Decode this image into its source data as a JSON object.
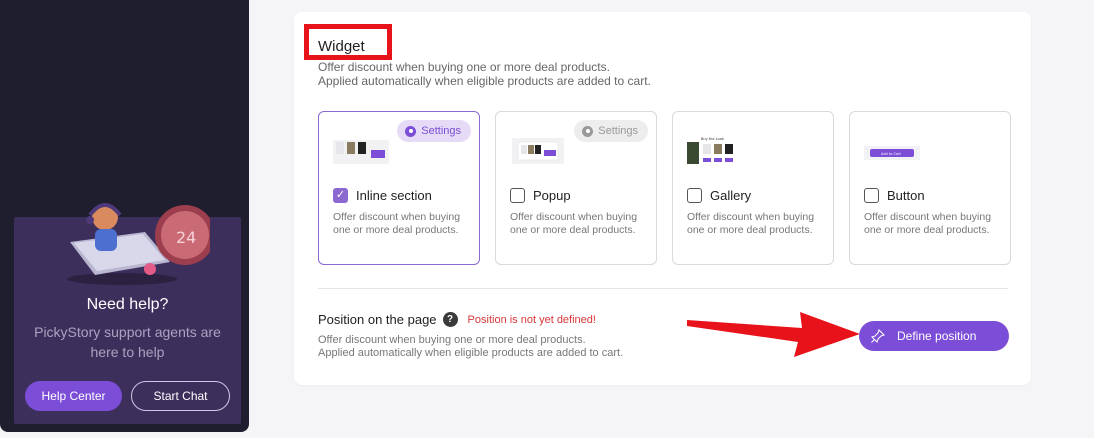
{
  "sidebar": {
    "help_title": "Need help?",
    "help_subtitle": "PickyStory support agents are here to help",
    "help_center_label": "Help Center",
    "start_chat_label": "Start Chat",
    "illustration_icon": "support-agent-phone-illustration"
  },
  "widget": {
    "title": "Widget",
    "desc_line1": "Offer discount when buying one or more deal products.",
    "desc_line2": "Applied automatically when eligible products are added to cart.",
    "options": [
      {
        "label": "Inline section",
        "checked": true,
        "settings": "Settings",
        "settings_enabled": true,
        "desc": "Offer discount when buying one or more deal products."
      },
      {
        "label": "Popup",
        "checked": false,
        "settings": "Settings",
        "settings_enabled": false,
        "desc": "Offer discount when buying one or more deal products."
      },
      {
        "label": "Gallery",
        "checked": false,
        "thumb_caption": "Buy the Look",
        "desc": "Offer discount when buying one or more deal products."
      },
      {
        "label": "Button",
        "checked": false,
        "thumb_caption": "Add to Cart",
        "desc": "Offer discount when buying one or more deal products."
      }
    ],
    "position": {
      "title": "Position on the page",
      "warning": "Position is not yet defined!",
      "desc_line1": "Offer discount when buying one or more deal products.",
      "desc_line2": "Applied automatically when eligible products are added to cart.",
      "define_label": "Define position"
    }
  },
  "colors": {
    "accent": "#7c4dd6",
    "sidebar_bg": "#1e1e2e",
    "help_card_bg": "#3d2f5c",
    "warning": "#d7373a",
    "annotation_red": "#e8121a"
  }
}
